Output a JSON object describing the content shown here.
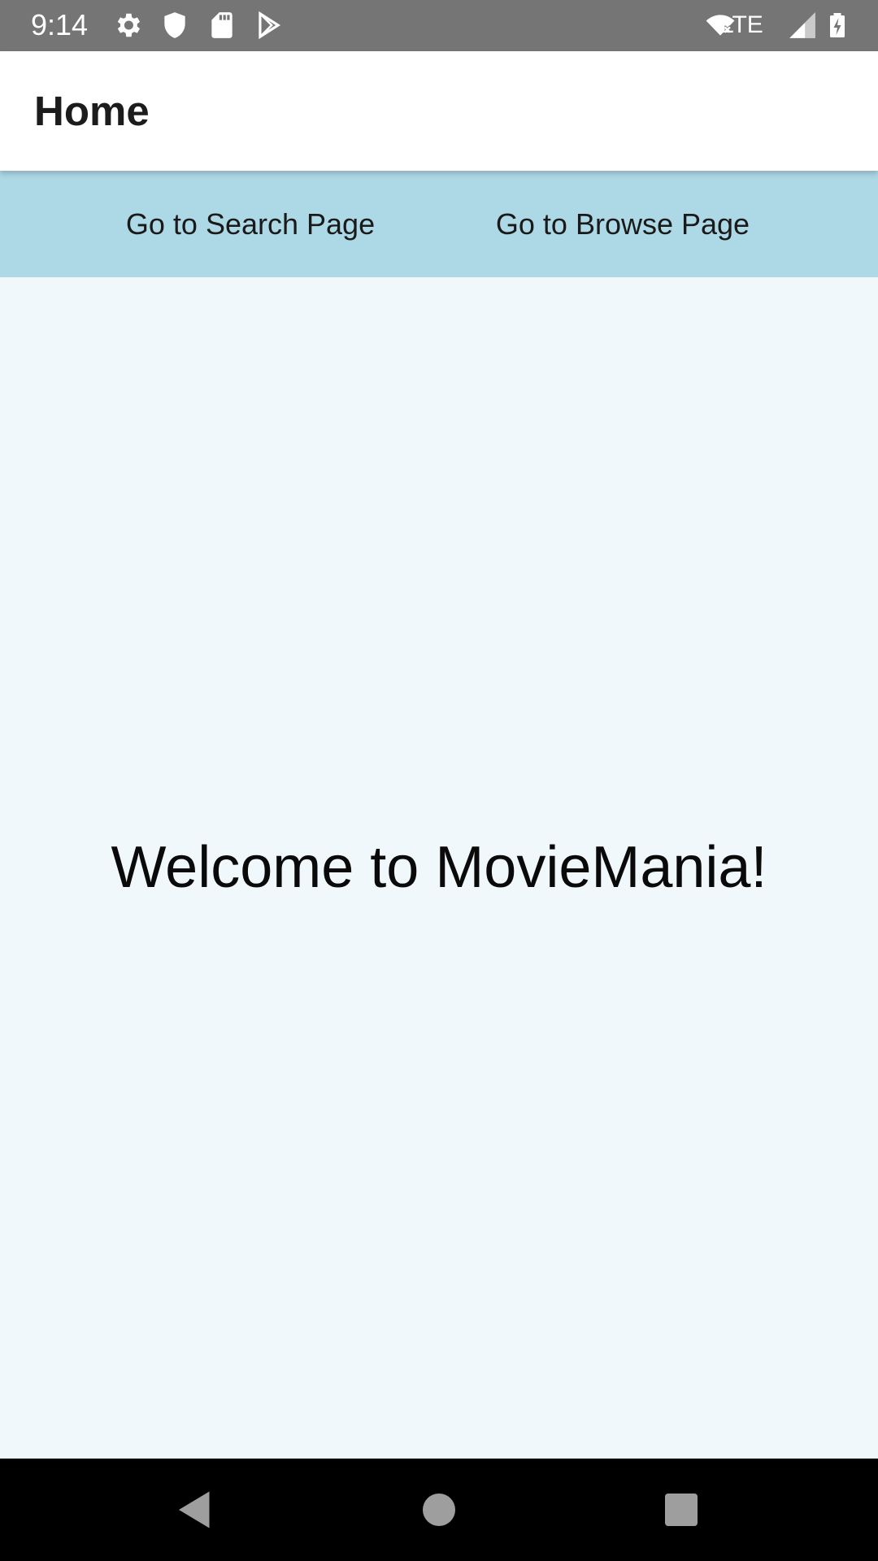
{
  "status_bar": {
    "time": "9:14",
    "network": "LTE",
    "icons": [
      "gear-icon",
      "shield-icon",
      "sd-card-icon",
      "play-store-icon",
      "wifi-off-icon",
      "signal-icon",
      "battery-charging-icon"
    ]
  },
  "app_bar": {
    "title": "Home"
  },
  "nav_row": {
    "search_label": "Go to Search Page",
    "browse_label": "Go to Browse Page"
  },
  "main": {
    "welcome_text": "Welcome to MovieMania!"
  },
  "system_nav": {
    "icons": [
      "back-icon",
      "home-icon",
      "recents-icon"
    ]
  },
  "colors": {
    "status_bar": "#757575",
    "app_bar": "#ffffff",
    "nav_row": "#add8e6",
    "background": "#f0f8fc",
    "system_nav": "#000000"
  }
}
